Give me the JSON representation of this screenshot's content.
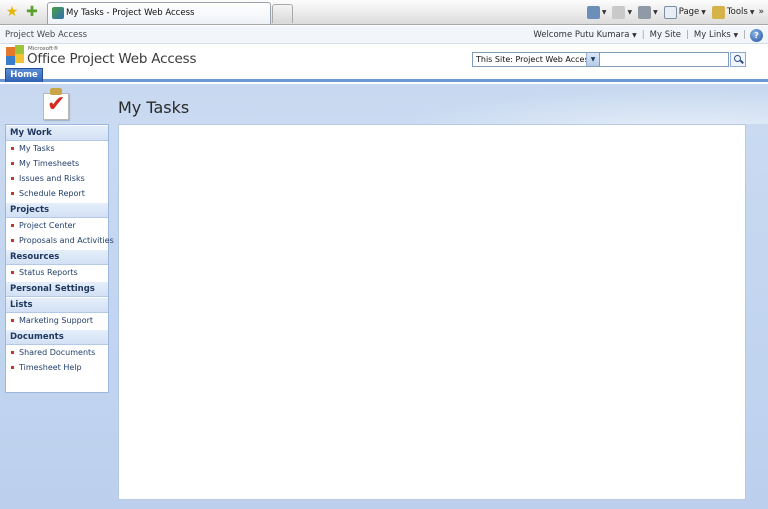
{
  "browser": {
    "tab_title": "My Tasks - Project Web Access",
    "toolbar": {
      "page_label": "Page",
      "tools_label": "Tools",
      "overflow": "»"
    }
  },
  "topbar": {
    "breadcrumb": "Project Web Access",
    "welcome": "Welcome Putu Kumara",
    "my_site": "My Site",
    "my_links": "My Links"
  },
  "header": {
    "logo_small": "Microsoft®",
    "logo_text": "Office Project Web Access",
    "scope_value": "This Site: Project Web Access",
    "search_value": ""
  },
  "tabs": [
    {
      "label": "Home",
      "active": true
    }
  ],
  "page": {
    "title": "My Tasks"
  },
  "quicklaunch": [
    {
      "heading": "My Work",
      "items": [
        "My Tasks",
        "My Timesheets",
        "Issues and Risks",
        "Schedule Report"
      ]
    },
    {
      "heading": "Projects",
      "items": [
        "Project Center",
        "Proposals and Activities"
      ]
    },
    {
      "heading": "Resources",
      "items": [
        "Status Reports"
      ]
    },
    {
      "heading": "Personal Settings",
      "items": []
    },
    {
      "heading": "Lists",
      "items": [
        "Marketing Support"
      ]
    },
    {
      "heading": "Documents",
      "items": [
        "Shared Documents",
        "Timesheet Help"
      ]
    }
  ],
  "colors": {
    "accent": "#2f62b6",
    "body_bg": "#c7d8f0",
    "bullet": "#c0392b"
  }
}
